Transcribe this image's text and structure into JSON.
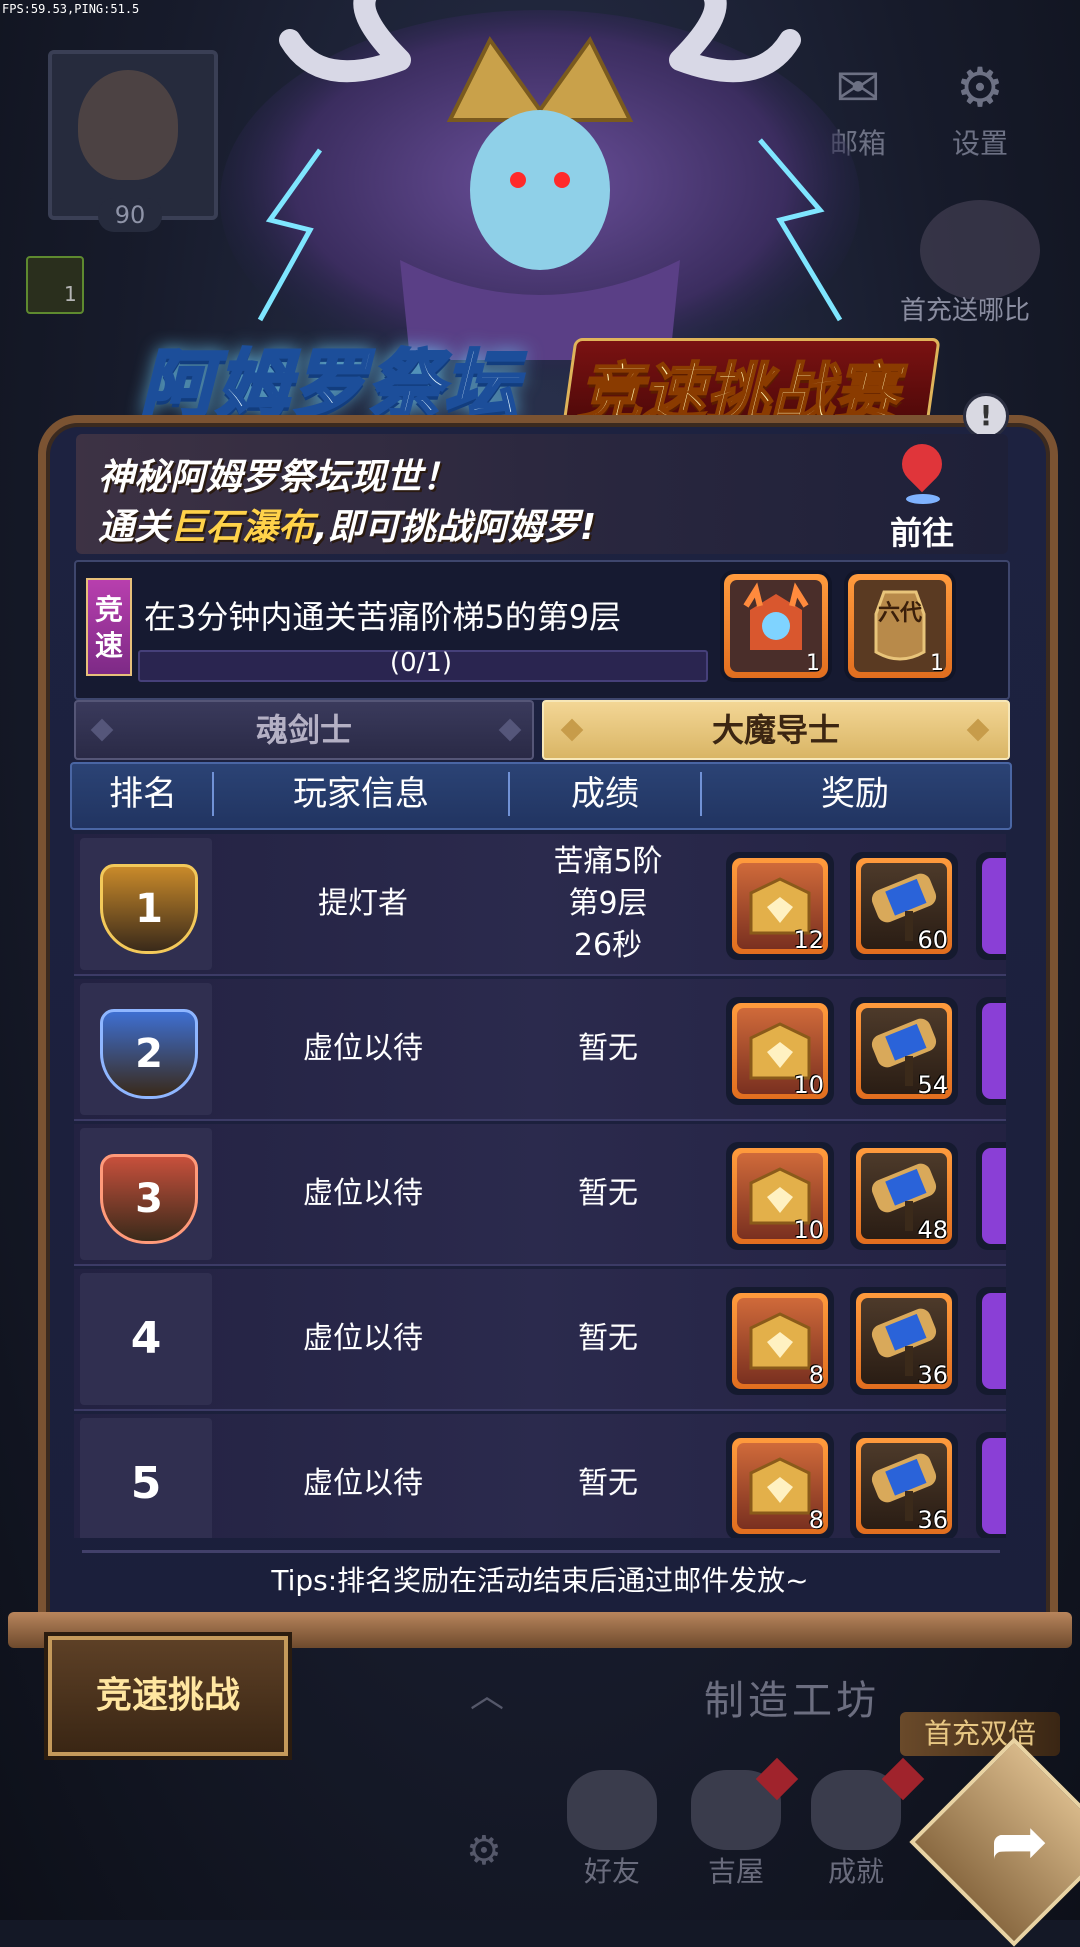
{
  "debug": {
    "fps_text": "FPS:59.53,PING:51.5"
  },
  "hud": {
    "player_level": "90",
    "buff_count": "1",
    "mail_label": "邮箱",
    "settings_label": "设置",
    "first_pay_gift": "首充送哪比"
  },
  "banner": {
    "title_part1": "阿姆罗祭坛",
    "title_part2": "竞速挑战赛",
    "info_icon": "exclamation-icon"
  },
  "intro": {
    "line1": "神秘阿姆罗祭坛现世！",
    "line2_prefix": "通关",
    "line2_highlight": "巨石瀑布",
    "line2_suffix": ",即可挑战阿姆罗!",
    "goto_label": "前往"
  },
  "challenge": {
    "tag": "竞速",
    "description": "在3分钟内通关苦痛阶梯5的第9层",
    "progress_text": "(0/1)",
    "progress_fraction": 0,
    "rewards": [
      {
        "icon": "demon-chest-icon",
        "count": "1"
      },
      {
        "icon": "sixth-gen-vase-icon",
        "text": "六代",
        "count": "1"
      }
    ]
  },
  "tabs": [
    {
      "label": "魂剑士",
      "active": false
    },
    {
      "label": "大魔导士",
      "active": true
    }
  ],
  "table": {
    "headers": [
      "排名",
      "玩家信息",
      "成绩",
      "奖励"
    ],
    "rows": [
      {
        "rank": "1",
        "medal": "gold",
        "player": "提灯者",
        "score": [
          "苦痛5阶",
          "第9层",
          "26秒"
        ],
        "rewards": [
          "12",
          "60"
        ]
      },
      {
        "rank": "2",
        "medal": "blue",
        "player": "虚位以待",
        "score": [
          "暂无"
        ],
        "rewards": [
          "10",
          "54"
        ]
      },
      {
        "rank": "3",
        "medal": "red",
        "player": "虚位以待",
        "score": [
          "暂无"
        ],
        "rewards": [
          "10",
          "48"
        ]
      },
      {
        "rank": "4",
        "medal": "none",
        "player": "虚位以待",
        "score": [
          "暂无"
        ],
        "rewards": [
          "8",
          "36"
        ]
      },
      {
        "rank": "5",
        "medal": "none",
        "player": "虚位以待",
        "score": [
          "暂无"
        ],
        "rewards": [
          "8",
          "36"
        ]
      }
    ]
  },
  "tips": "Tips:排名奖励在活动结束后通过邮件发放~",
  "bottom": {
    "speed_challenge_button": "竞速挑战",
    "craft_label": "制造工坊",
    "first_pay_double": "首充双倍",
    "nav": [
      {
        "label": "好友",
        "alert": false
      },
      {
        "label": "吉屋",
        "alert": true
      },
      {
        "label": "成就",
        "alert": true
      }
    ]
  },
  "colors": {
    "accent_gold": "#d9b565",
    "panel_bg": "#1b1f3b",
    "progress_fill": "#8a69ff",
    "reward_frame": "#e16e1f"
  }
}
